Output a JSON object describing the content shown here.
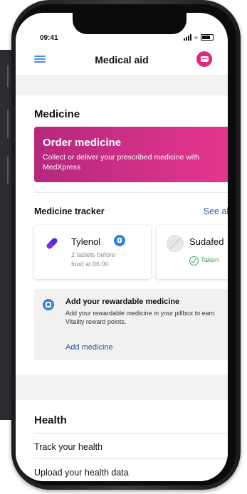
{
  "status_bar": {
    "time": "09:41"
  },
  "header": {
    "title": "Medical aid"
  },
  "medicine": {
    "section_title": "Medicine",
    "order": {
      "title": "Order medicine",
      "description": "Collect or deliver your prescribed medicine with MedXpress"
    }
  },
  "tracker": {
    "title": "Medicine tracker",
    "see_all": "See all",
    "cards": [
      {
        "name": "Tylenol",
        "detail": "2 tablets before food at 06:00"
      },
      {
        "name": "Sudafed",
        "status": "Taken"
      }
    ]
  },
  "reward": {
    "title": "Add your rewardable medicine",
    "description": "Add your rewardable medicine in your pillbox to earn Vitality reward points.",
    "link": "Add medicine"
  },
  "health": {
    "section_title": "Health",
    "rows": [
      {
        "label": "Track your health"
      },
      {
        "label": "Upload your health data"
      }
    ]
  },
  "colors": {
    "accent_blue": "#1f5ea8",
    "brand_pink": "#e3267c",
    "taken_green": "#3aa655"
  }
}
